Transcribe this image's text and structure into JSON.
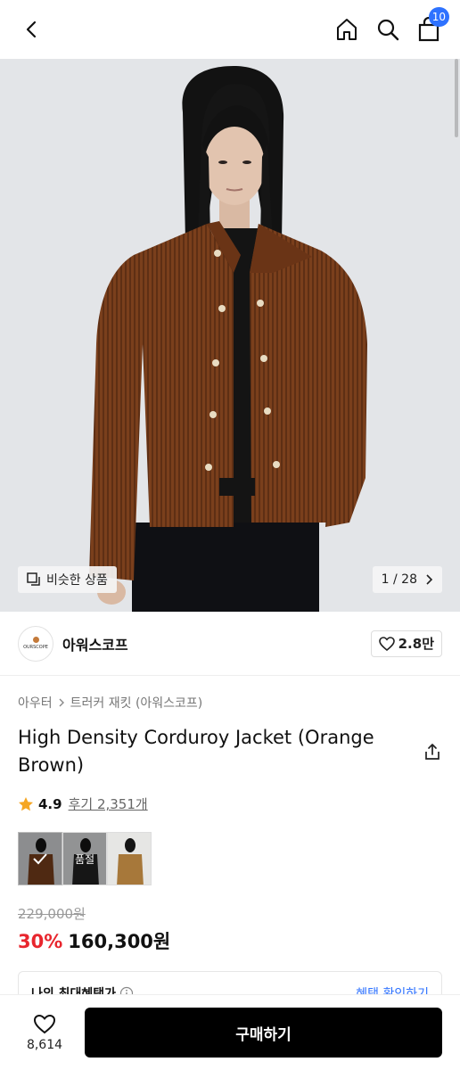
{
  "header": {
    "back_icon": "chevron-left-icon",
    "home_icon": "home-icon",
    "search_icon": "search-icon",
    "cart_icon": "shopping-bag-icon",
    "cart_count": "10"
  },
  "gallery": {
    "similar_label": "비슷한 상품",
    "page_indicator": "1 / 28"
  },
  "brand": {
    "logo_text": "OURSCOPE",
    "name": "아워스코프",
    "likes": "2.8만"
  },
  "breadcrumb": {
    "category": "아우터",
    "subcategory": "트러커 재킷 (아워스코프)"
  },
  "product": {
    "title": "High Density Corduroy Jacket (Orange Brown)",
    "rating": "4.9",
    "reviews": "후기 2,351개",
    "soldout_label": "품절",
    "original_price": "229,000원",
    "discount": "30%",
    "sale_price": "160,300원"
  },
  "benefit": {
    "label": "나의 최대혜택가",
    "link": "혜택 확인하기"
  },
  "bottom": {
    "like_count": "8,614",
    "buy_label": "구매하기"
  },
  "colors": {
    "accent_blue": "#2e72ff",
    "discount_red": "#e8262e",
    "jacket_brown": "#7a3f1c"
  }
}
